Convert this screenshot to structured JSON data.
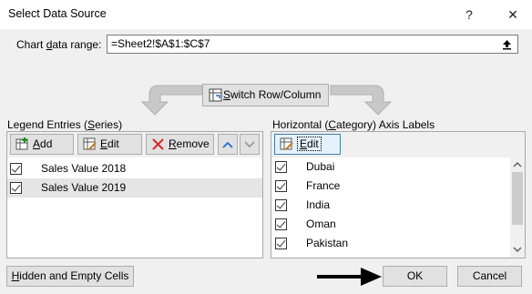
{
  "window": {
    "title": "Select Data Source",
    "help": "?",
    "close": "✕"
  },
  "range": {
    "label": "Chart data range:",
    "value": "=Sheet2!$A$1:$C$7"
  },
  "switch_button": "Switch Row/Column",
  "legend": {
    "label": "Legend Entries (Series)",
    "buttons": {
      "add": "Add",
      "edit": "Edit",
      "remove": "Remove"
    },
    "items": [
      {
        "label": "Sales Value 2018",
        "checked": true,
        "selected": false
      },
      {
        "label": "Sales Value 2019",
        "checked": true,
        "selected": true
      }
    ]
  },
  "axis": {
    "label": "Horizontal (Category) Axis Labels",
    "edit": "Edit",
    "items": [
      {
        "label": "Dubai",
        "checked": true
      },
      {
        "label": "France",
        "checked": true
      },
      {
        "label": "India",
        "checked": true
      },
      {
        "label": "Oman",
        "checked": true
      },
      {
        "label": "Pakistan",
        "checked": true
      }
    ]
  },
  "footer": {
    "hidden_empty": "Hidden and Empty Cells",
    "ok": "OK",
    "cancel": "Cancel"
  }
}
